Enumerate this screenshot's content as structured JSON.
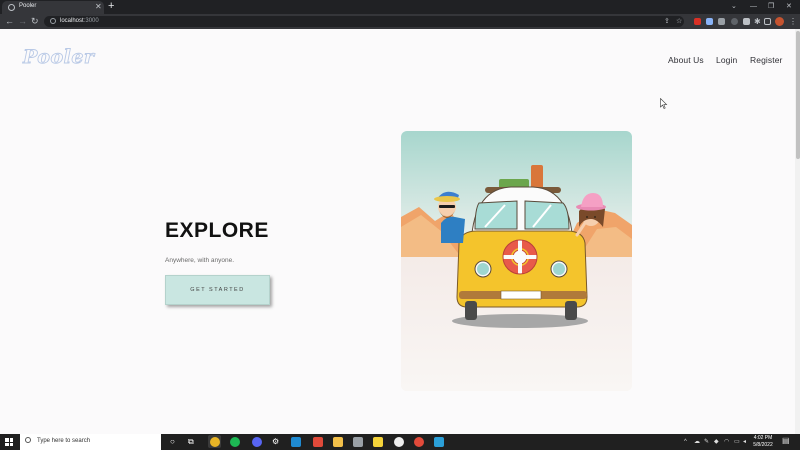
{
  "browser": {
    "tab_title": "Pooler",
    "tab_close_icon": "close-icon",
    "new_tab_icon": "plus-icon",
    "url_host": "localhost",
    "url_port": ":3000",
    "window_controls": [
      "chevron-down-icon",
      "minimize-icon",
      "restore-icon",
      "close-icon"
    ]
  },
  "site": {
    "logo": "Pooler",
    "nav": {
      "about": "About Us",
      "login": "Login",
      "register": "Register"
    }
  },
  "hero": {
    "title": "EXPLORE",
    "subtitle": "Anywhere, with anyone.",
    "cta": "GET STARTED",
    "accent_color": "#c9e6e1"
  },
  "taskbar": {
    "search_placeholder": "Type here to search",
    "time": "4:02 PM",
    "date": "5/8/2022"
  }
}
